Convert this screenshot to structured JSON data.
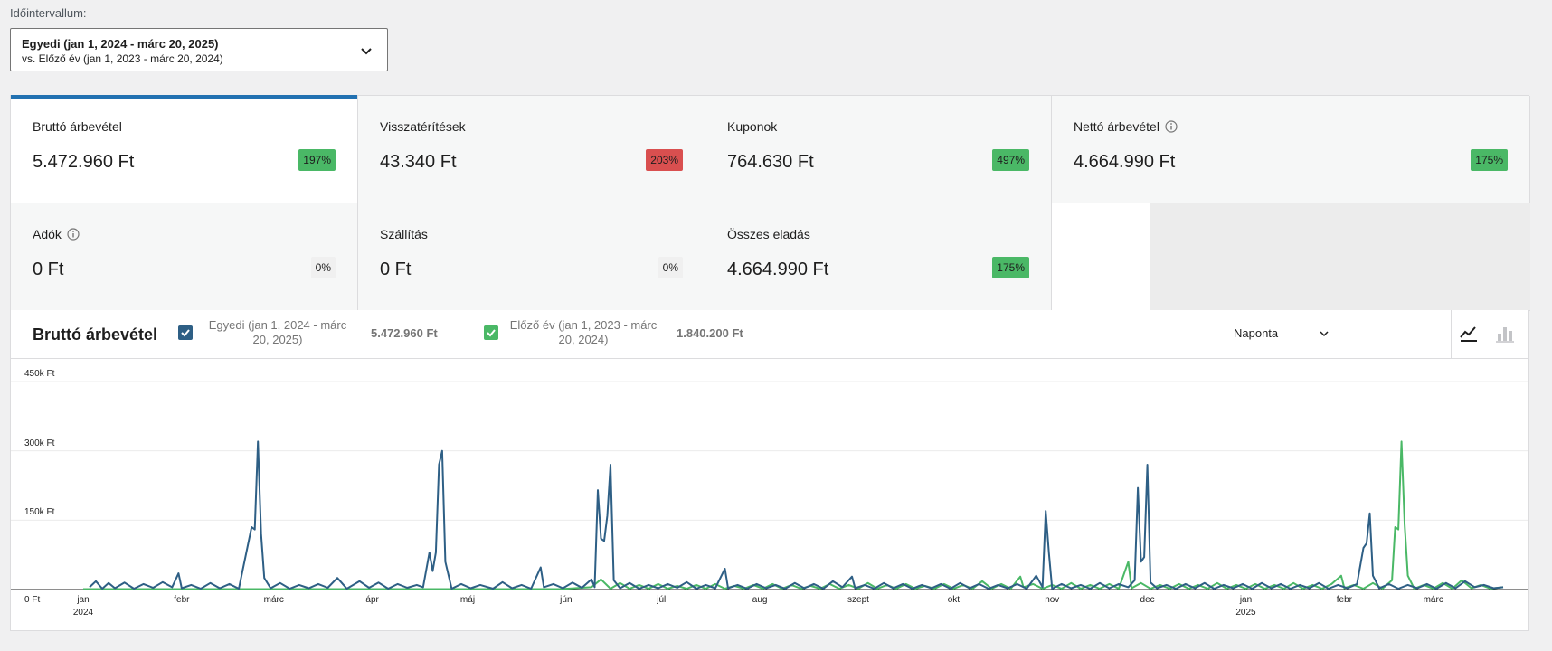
{
  "range": {
    "label": "Időintervallum:",
    "primary": "Egyedi (jan 1, 2024 - márc 20, 2025)",
    "secondary": "vs. Előző év (jan 1, 2023 - márc 20, 2024)"
  },
  "tiles": [
    {
      "label": "Bruttó árbevétel",
      "value": "5.472.960 Ft",
      "delta": "197%",
      "trend": "up",
      "selected": true
    },
    {
      "label": "Visszatérítések",
      "value": "43.340 Ft",
      "delta": "203%",
      "trend": "down"
    },
    {
      "label": "Kuponok",
      "value": "764.630 Ft",
      "delta": "497%",
      "trend": "up"
    },
    {
      "label": "Nettó árbevétel",
      "value": "4.664.990 Ft",
      "delta": "175%",
      "trend": "up",
      "info": true
    },
    {
      "label": "Adók",
      "value": "0 Ft",
      "delta": "0%",
      "trend": "neutral",
      "info": true
    },
    {
      "label": "Szállítás",
      "value": "0 Ft",
      "delta": "0%",
      "trend": "neutral"
    },
    {
      "label": "Összes eladás",
      "value": "4.664.990 Ft",
      "delta": "175%",
      "trend": "up"
    }
  ],
  "chart": {
    "title": "Bruttó árbevétel",
    "interval": "Naponta",
    "legend": [
      {
        "label": "Egyedi (jan 1, 2024 - márc 20, 2025)",
        "total": "5.472.960 Ft",
        "color": "#2e5f85",
        "checked": true
      },
      {
        "label": "Előző év (jan 1, 2023 - márc 20, 2024)",
        "total": "1.840.200 Ft",
        "color": "#4ab866",
        "checked": true
      }
    ]
  },
  "chart_data": {
    "type": "line",
    "y_ticks": [
      "0 Ft",
      "150k Ft",
      "300k Ft",
      "450k Ft"
    ],
    "x_ticks": [
      {
        "label": "jan",
        "sub": "2024"
      },
      {
        "label": "febr"
      },
      {
        "label": "márc"
      },
      {
        "label": "ápr"
      },
      {
        "label": "máj"
      },
      {
        "label": "jún"
      },
      {
        "label": "júl"
      },
      {
        "label": "aug"
      },
      {
        "label": "szept"
      },
      {
        "label": "okt"
      },
      {
        "label": "nov"
      },
      {
        "label": "dec"
      },
      {
        "label": "jan",
        "sub": "2025"
      },
      {
        "label": "febr"
      },
      {
        "label": "márc"
      }
    ],
    "ylim": [
      0,
      450000
    ],
    "series": [
      {
        "name": "Egyedi (jan 1, 2024 - márc 20, 2025)",
        "color": "#2e5f85",
        "points": [
          [
            2,
            5000
          ],
          [
            4,
            18000
          ],
          [
            6,
            2000
          ],
          [
            8,
            14000
          ],
          [
            10,
            3000
          ],
          [
            13,
            15000
          ],
          [
            16,
            2000
          ],
          [
            19,
            12000
          ],
          [
            22,
            4000
          ],
          [
            25,
            16000
          ],
          [
            28,
            5000
          ],
          [
            30,
            35000
          ],
          [
            31,
            3000
          ],
          [
            34,
            10000
          ],
          [
            37,
            2000
          ],
          [
            40,
            14000
          ],
          [
            43,
            3000
          ],
          [
            46,
            12000
          ],
          [
            49,
            2000
          ],
          [
            53,
            135000
          ],
          [
            54,
            130000
          ],
          [
            55,
            320000
          ],
          [
            56,
            120000
          ],
          [
            57,
            25000
          ],
          [
            59,
            3000
          ],
          [
            62,
            14000
          ],
          [
            65,
            2000
          ],
          [
            68,
            10000
          ],
          [
            71,
            3000
          ],
          [
            74,
            12000
          ],
          [
            77,
            4000
          ],
          [
            80,
            25000
          ],
          [
            83,
            2000
          ],
          [
            87,
            18000
          ],
          [
            90,
            4000
          ],
          [
            93,
            15000
          ],
          [
            96,
            2000
          ],
          [
            99,
            12000
          ],
          [
            102,
            4000
          ],
          [
            105,
            10000
          ],
          [
            107,
            5000
          ],
          [
            109,
            80000
          ],
          [
            110,
            40000
          ],
          [
            111,
            80000
          ],
          [
            112,
            270000
          ],
          [
            113,
            300000
          ],
          [
            114,
            60000
          ],
          [
            116,
            2000
          ],
          [
            119,
            12000
          ],
          [
            122,
            3000
          ],
          [
            125,
            10000
          ],
          [
            129,
            2000
          ],
          [
            132,
            16000
          ],
          [
            135,
            3000
          ],
          [
            138,
            10000
          ],
          [
            141,
            2000
          ],
          [
            144,
            48000
          ],
          [
            145,
            5000
          ],
          [
            148,
            12000
          ],
          [
            151,
            3000
          ],
          [
            154,
            15000
          ],
          [
            157,
            4000
          ],
          [
            160,
            22000
          ],
          [
            161,
            5000
          ],
          [
            162,
            215000
          ],
          [
            163,
            110000
          ],
          [
            164,
            105000
          ],
          [
            165,
            160000
          ],
          [
            166,
            270000
          ],
          [
            167,
            20000
          ],
          [
            169,
            3000
          ],
          [
            172,
            14000
          ],
          [
            175,
            2000
          ],
          [
            178,
            10000
          ],
          [
            181,
            3000
          ],
          [
            184,
            12000
          ],
          [
            187,
            4000
          ],
          [
            190,
            16000
          ],
          [
            193,
            2000
          ],
          [
            196,
            10000
          ],
          [
            199,
            3000
          ],
          [
            202,
            45000
          ],
          [
            203,
            3000
          ],
          [
            206,
            10000
          ],
          [
            209,
            2000
          ],
          [
            212,
            12000
          ],
          [
            215,
            3000
          ],
          [
            218,
            10000
          ],
          [
            221,
            2000
          ],
          [
            224,
            14000
          ],
          [
            227,
            3000
          ],
          [
            230,
            12000
          ],
          [
            233,
            2000
          ],
          [
            236,
            18000
          ],
          [
            239,
            5000
          ],
          [
            242,
            28000
          ],
          [
            243,
            3000
          ],
          [
            246,
            10000
          ],
          [
            249,
            2000
          ],
          [
            252,
            14000
          ],
          [
            255,
            3000
          ],
          [
            258,
            12000
          ],
          [
            261,
            2000
          ],
          [
            264,
            10000
          ],
          [
            267,
            3000
          ],
          [
            270,
            12000
          ],
          [
            273,
            2000
          ],
          [
            276,
            14000
          ],
          [
            279,
            3000
          ],
          [
            282,
            12000
          ],
          [
            285,
            2000
          ],
          [
            288,
            10000
          ],
          [
            291,
            3000
          ],
          [
            294,
            12000
          ],
          [
            297,
            2000
          ],
          [
            300,
            30000
          ],
          [
            302,
            5000
          ],
          [
            303,
            170000
          ],
          [
            304,
            80000
          ],
          [
            305,
            2000
          ],
          [
            308,
            12000
          ],
          [
            311,
            3000
          ],
          [
            314,
            10000
          ],
          [
            317,
            2000
          ],
          [
            320,
            14000
          ],
          [
            323,
            3000
          ],
          [
            326,
            12000
          ],
          [
            329,
            5000
          ],
          [
            331,
            20000
          ],
          [
            332,
            220000
          ],
          [
            333,
            60000
          ],
          [
            334,
            70000
          ],
          [
            335,
            270000
          ],
          [
            336,
            15000
          ],
          [
            338,
            3000
          ],
          [
            341,
            10000
          ],
          [
            344,
            2000
          ],
          [
            347,
            12000
          ],
          [
            350,
            3000
          ],
          [
            353,
            14000
          ],
          [
            356,
            2000
          ],
          [
            359,
            10000
          ],
          [
            362,
            3000
          ],
          [
            365,
            12000
          ],
          [
            368,
            2000
          ],
          [
            371,
            14000
          ],
          [
            374,
            3000
          ],
          [
            377,
            12000
          ],
          [
            380,
            2000
          ],
          [
            383,
            10000
          ],
          [
            386,
            3000
          ],
          [
            389,
            14000
          ],
          [
            392,
            2000
          ],
          [
            395,
            10000
          ],
          [
            398,
            3000
          ],
          [
            401,
            12000
          ],
          [
            403,
            90000
          ],
          [
            404,
            100000
          ],
          [
            405,
            165000
          ],
          [
            406,
            30000
          ],
          [
            408,
            3000
          ],
          [
            411,
            12000
          ],
          [
            414,
            2000
          ],
          [
            417,
            10000
          ],
          [
            420,
            3000
          ],
          [
            423,
            12000
          ],
          [
            426,
            2000
          ],
          [
            429,
            14000
          ],
          [
            432,
            3000
          ],
          [
            435,
            18000
          ],
          [
            438,
            5000
          ],
          [
            441,
            10000
          ],
          [
            444,
            3000
          ],
          [
            447,
            5000
          ]
        ]
      },
      {
        "name": "Előző év (jan 1, 2023 - márc 20, 2024)",
        "color": "#4ab866",
        "points": [
          [
            0,
            1000
          ],
          [
            50,
            1000
          ],
          [
            100,
            1000
          ],
          [
            150,
            1000
          ],
          [
            160,
            5000
          ],
          [
            163,
            22000
          ],
          [
            166,
            2000
          ],
          [
            169,
            14000
          ],
          [
            172,
            2000
          ],
          [
            175,
            10000
          ],
          [
            178,
            2000
          ],
          [
            181,
            12000
          ],
          [
            184,
            2000
          ],
          [
            187,
            8000
          ],
          [
            190,
            2000
          ],
          [
            193,
            10000
          ],
          [
            196,
            2000
          ],
          [
            199,
            12000
          ],
          [
            202,
            2000
          ],
          [
            205,
            8000
          ],
          [
            208,
            2000
          ],
          [
            211,
            10000
          ],
          [
            214,
            2000
          ],
          [
            217,
            12000
          ],
          [
            220,
            2000
          ],
          [
            223,
            10000
          ],
          [
            226,
            2000
          ],
          [
            229,
            8000
          ],
          [
            232,
            2000
          ],
          [
            235,
            12000
          ],
          [
            238,
            2000
          ],
          [
            241,
            10000
          ],
          [
            244,
            2000
          ],
          [
            247,
            14000
          ],
          [
            250,
            2000
          ],
          [
            253,
            10000
          ],
          [
            256,
            2000
          ],
          [
            259,
            12000
          ],
          [
            262,
            2000
          ],
          [
            265,
            8000
          ],
          [
            268,
            2000
          ],
          [
            271,
            12000
          ],
          [
            274,
            2000
          ],
          [
            277,
            10000
          ],
          [
            280,
            2000
          ],
          [
            283,
            18000
          ],
          [
            286,
            2000
          ],
          [
            289,
            12000
          ],
          [
            292,
            2000
          ],
          [
            295,
            28000
          ],
          [
            296,
            5000
          ],
          [
            299,
            12000
          ],
          [
            302,
            2000
          ],
          [
            305,
            10000
          ],
          [
            308,
            2000
          ],
          [
            311,
            14000
          ],
          [
            314,
            2000
          ],
          [
            317,
            10000
          ],
          [
            320,
            2000
          ],
          [
            323,
            12000
          ],
          [
            326,
            2000
          ],
          [
            329,
            60000
          ],
          [
            330,
            3000
          ],
          [
            333,
            14000
          ],
          [
            336,
            2000
          ],
          [
            339,
            10000
          ],
          [
            342,
            2000
          ],
          [
            345,
            12000
          ],
          [
            348,
            2000
          ],
          [
            351,
            10000
          ],
          [
            354,
            2000
          ],
          [
            357,
            14000
          ],
          [
            360,
            2000
          ],
          [
            363,
            10000
          ],
          [
            366,
            2000
          ],
          [
            369,
            12000
          ],
          [
            372,
            2000
          ],
          [
            375,
            10000
          ],
          [
            378,
            2000
          ],
          [
            381,
            14000
          ],
          [
            384,
            2000
          ],
          [
            387,
            10000
          ],
          [
            390,
            2000
          ],
          [
            393,
            12000
          ],
          [
            396,
            30000
          ],
          [
            397,
            3000
          ],
          [
            400,
            10000
          ],
          [
            403,
            2000
          ],
          [
            406,
            14000
          ],
          [
            409,
            2000
          ],
          [
            412,
            20000
          ],
          [
            413,
            135000
          ],
          [
            414,
            130000
          ],
          [
            415,
            320000
          ],
          [
            416,
            140000
          ],
          [
            417,
            30000
          ],
          [
            419,
            2000
          ],
          [
            422,
            10000
          ],
          [
            425,
            2000
          ],
          [
            428,
            14000
          ],
          [
            431,
            2000
          ],
          [
            434,
            20000
          ],
          [
            437,
            3000
          ],
          [
            440,
            10000
          ],
          [
            443,
            2000
          ],
          [
            447,
            5000
          ]
        ]
      }
    ]
  }
}
